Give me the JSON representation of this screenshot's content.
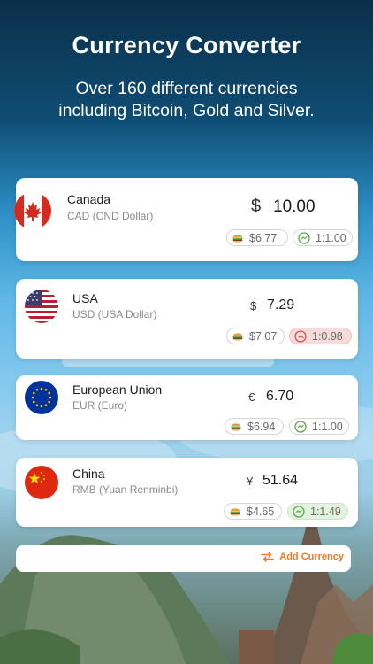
{
  "header": {
    "title": "Currency Converter",
    "subtitle_line1": "Over 160 different currencies",
    "subtitle_line2": "including Bitcoin, Gold and Silver."
  },
  "currencies": [
    {
      "name": "Canada",
      "code": "CAD (CND Dollar)",
      "symbol": "$",
      "amount": "10.00",
      "burger": "$6.77",
      "rate": "1:1.00",
      "rate_status": "neutral",
      "flag": "canada-flag-icon"
    },
    {
      "name": "USA",
      "code": "USD (USA Dollar)",
      "symbol": "$",
      "amount": "7.29",
      "burger": "$7.07",
      "rate": "1:0.98",
      "rate_status": "negative",
      "flag": "usa-flag-icon"
    },
    {
      "name": "European Union",
      "code": "EUR (Euro)",
      "symbol": "€",
      "amount": "6.70",
      "burger": "$6.94",
      "rate": "1:1.00",
      "rate_status": "neutral",
      "flag": "eu-flag-icon"
    },
    {
      "name": "China",
      "code": "RMB (Yuan Renminbi)",
      "symbol": "¥",
      "amount": "51.64",
      "burger": "$4.65",
      "rate": "1:1.49",
      "rate_status": "positive",
      "flag": "china-flag-icon"
    }
  ],
  "add_currency_label": "Add Currency",
  "colors": {
    "accent": "#f07a23",
    "positive_bg": "#e4f3df",
    "negative_bg": "#f5dcdb",
    "rate_icon_green": "#5aa84a",
    "rate_icon_red": "#d9534f"
  }
}
